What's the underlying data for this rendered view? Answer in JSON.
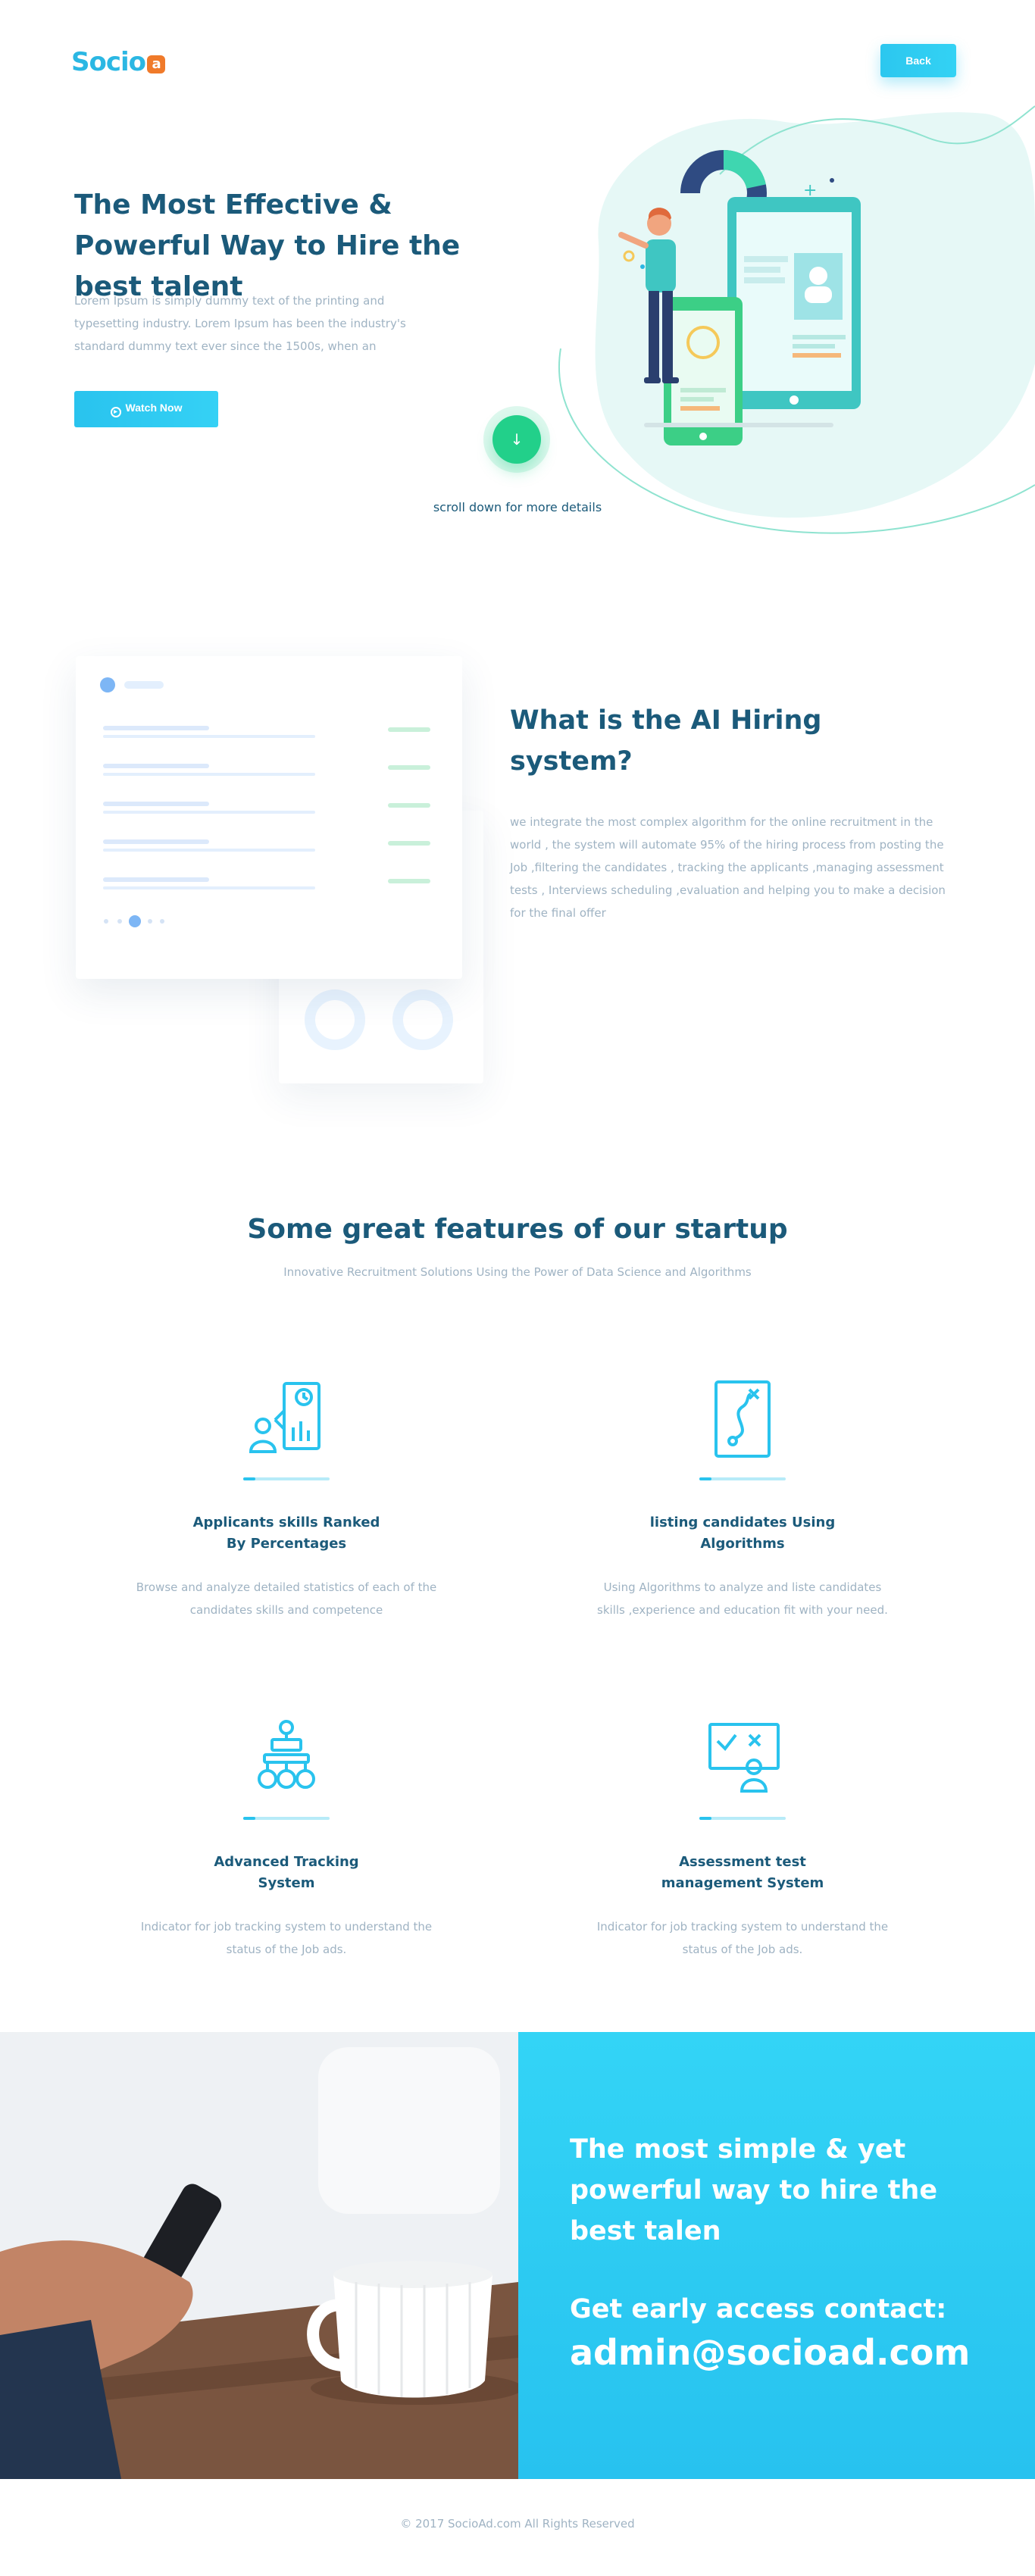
{
  "header": {
    "logo_text": "Socio",
    "logo_badge": "a",
    "back_label": "Back"
  },
  "hero": {
    "title": "The Most Effective & Powerful Way to Hire the best talent",
    "description": "Lorem Ipsum is simply dummy text of the printing and typesetting industry. Lorem Ipsum has been the industry's standard dummy text ever since the 1500s, when an",
    "watch_label": "Watch Now",
    "scroll_arrow": "↓",
    "scroll_text": "scroll down for more details"
  },
  "what": {
    "title": "What is the AI Hiring system?",
    "description": "we integrate the most complex algorithm for the online recruitment in the world , the system will automate 95% of the hiring process from posting the Job ,filtering the candidates , tracking the applicants ,managing assessment tests , Interviews scheduling ,evaluation and helping you to make a decision for the final offer"
  },
  "features": {
    "title": "Some great features of our startup",
    "subtitle": "Innovative Recruitment Solutions Using the Power of Data Science and Algorithms",
    "items": [
      {
        "icon": "ranking-chart-icon",
        "title": "Applicants skills Ranked\nBy Percentages",
        "description": "Browse and analyze detailed statistics of each of the\ncandidates skills and competence"
      },
      {
        "icon": "algorithm-path-icon",
        "title": "listing candidates Using\nAlgorithms",
        "description": "Using Algorithms to analyze and  liste candidates\nskills ,experience  and education fit with your need."
      },
      {
        "icon": "org-tracking-icon",
        "title": "Advanced Tracking\nSystem",
        "description": "Indicator for job tracking system to understand the\nstatus of the Job ads."
      },
      {
        "icon": "assessment-board-icon",
        "title": "Assessment test\nmanagement System",
        "description": "Indicator for job tracking system to understand the\nstatus of the Job ads."
      }
    ]
  },
  "cta": {
    "headline": "The most simple & yet powerful way to hire the best talen",
    "contact_label": "Get early access contact:",
    "email": "admin@socioad.com"
  },
  "footer": {
    "copyright": "© 2017 SocioAd.com All Rights Reserved"
  },
  "colors": {
    "brand": "#2bb7e3",
    "heading": "#1b5a7a",
    "body_text": "#9fb3c3",
    "accent_green": "#22d08a",
    "cta_panel": "#2fcbf3",
    "logo_badge": "#f07a2a"
  }
}
